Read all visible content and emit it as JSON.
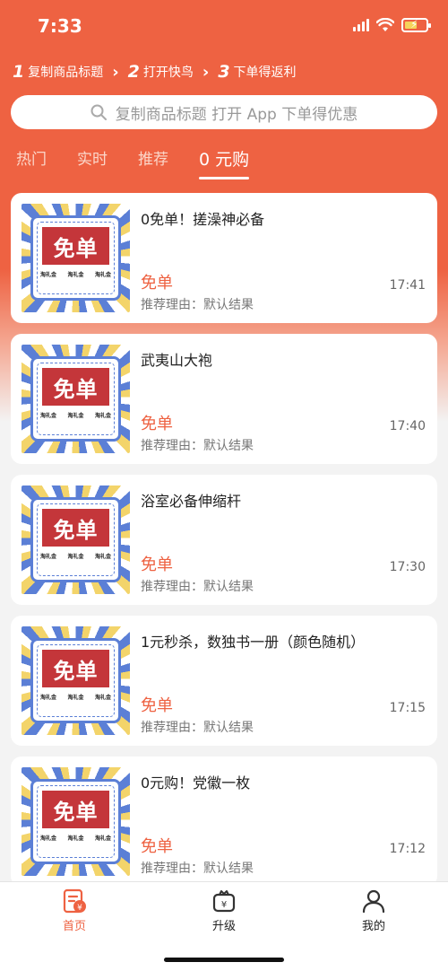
{
  "status": {
    "time": "7:33"
  },
  "steps": [
    {
      "num": "1",
      "label": "复制商品标题"
    },
    {
      "num": "2",
      "label": "打开快鸟"
    },
    {
      "num": "3",
      "label": "下单得返利"
    }
  ],
  "search": {
    "placeholder": "复制商品标题 打开 App 下单得优惠"
  },
  "tabs": [
    {
      "label": "热门"
    },
    {
      "label": "实时"
    },
    {
      "label": "推荐"
    },
    {
      "label": "0 元购",
      "active": true
    }
  ],
  "thumb": {
    "banner": "免单",
    "small": [
      "淘礼金",
      "淘礼金",
      "淘礼金"
    ]
  },
  "reason_label": "推荐理由：",
  "items": [
    {
      "title": "0免单！搓澡神必备",
      "tag": "免单",
      "reason": "默认结果",
      "time": "17:41"
    },
    {
      "title": "武夷山大袍",
      "tag": "免单",
      "reason": "默认结果",
      "time": "17:40"
    },
    {
      "title": "浴室必备伸缩杆",
      "tag": "免单",
      "reason": "默认结果",
      "time": "17:30"
    },
    {
      "title": "1元秒杀，数独书一册（颜色随机）",
      "tag": "免单",
      "reason": "默认结果",
      "time": "17:15"
    },
    {
      "title": "0元购！党徽一枚",
      "tag": "免单",
      "reason": "默认结果",
      "time": "17:12"
    }
  ],
  "tabbar": [
    {
      "label": "首页",
      "icon": "home-receipt-icon",
      "active": true
    },
    {
      "label": "升级",
      "icon": "upgrade-bag-icon"
    },
    {
      "label": "我的",
      "icon": "user-icon"
    }
  ],
  "colors": {
    "accent": "#ee6242",
    "banner": "#c4363a",
    "ray_blue": "#5b7fd6",
    "ray_yellow": "#f3d46a"
  }
}
